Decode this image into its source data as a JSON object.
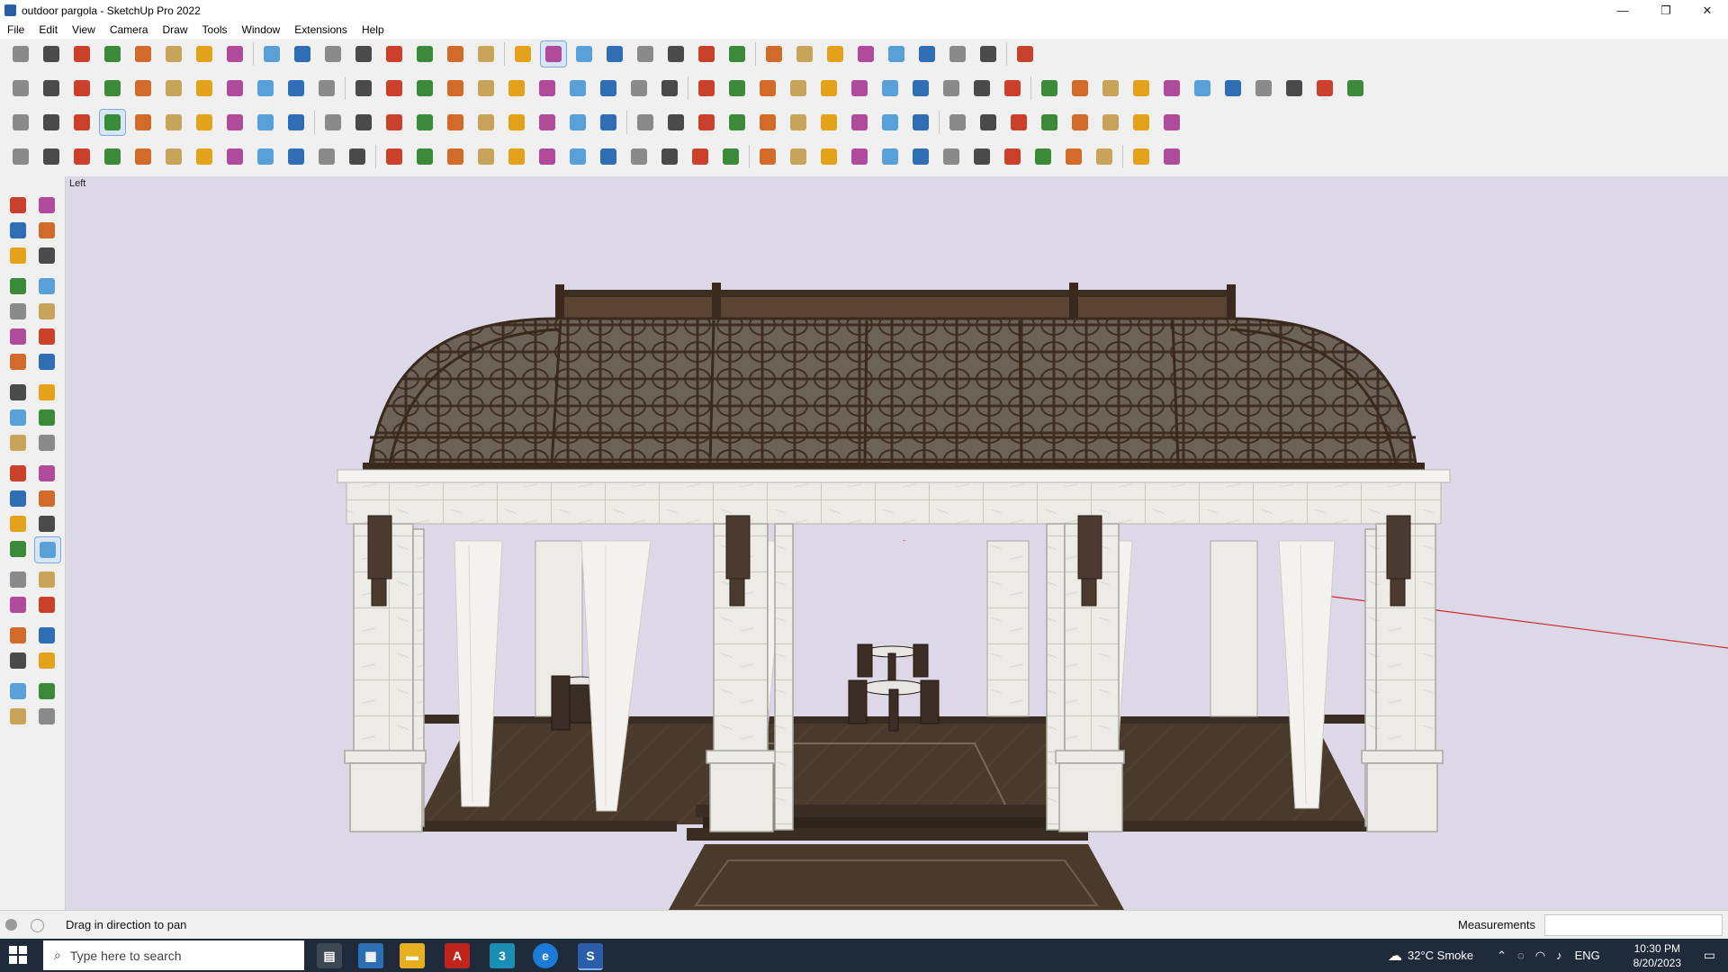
{
  "window": {
    "title": "outdoor pargola - SketchUp Pro 2022",
    "minimize_glyph": "—",
    "maximize_glyph": "❐",
    "close_glyph": "✕"
  },
  "menu": [
    "File",
    "Edit",
    "View",
    "Camera",
    "Draw",
    "Tools",
    "Window",
    "Extensions",
    "Help"
  ],
  "toolbars": {
    "row1_count": 33,
    "row2_count": 44,
    "row3_count": 38,
    "row4_count": 38
  },
  "viewport": {
    "scene_label": "Left",
    "background": "#ddd8e8",
    "axis_color": "#cc2a2a"
  },
  "status": {
    "message": "Drag in direction to pan",
    "measurements_label": "Measurements",
    "measurements_value": ""
  },
  "taskbar": {
    "search_placeholder": "Type here to search",
    "weather": "32°C  Smoke",
    "language": "ENG",
    "time": "10:30 PM",
    "date": "8/20/2023"
  },
  "colors": {
    "accent": "#2a5ea8",
    "roof": "#4e3a2c",
    "stone": "#ecebe6",
    "floor": "#4a3a2c",
    "curtain": "#f4f2ee"
  }
}
